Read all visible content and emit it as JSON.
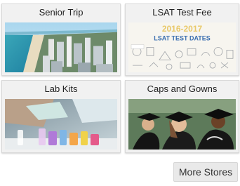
{
  "stores": [
    {
      "title": "Senior Trip"
    },
    {
      "title": "LSAT Test Fee",
      "image_text": {
        "years": "2016-2017",
        "heading": "LSAT TEST DATES"
      }
    },
    {
      "title": "Lab Kits"
    },
    {
      "title": "Caps and Gowns"
    }
  ],
  "more_button": {
    "label": "More Stores"
  }
}
